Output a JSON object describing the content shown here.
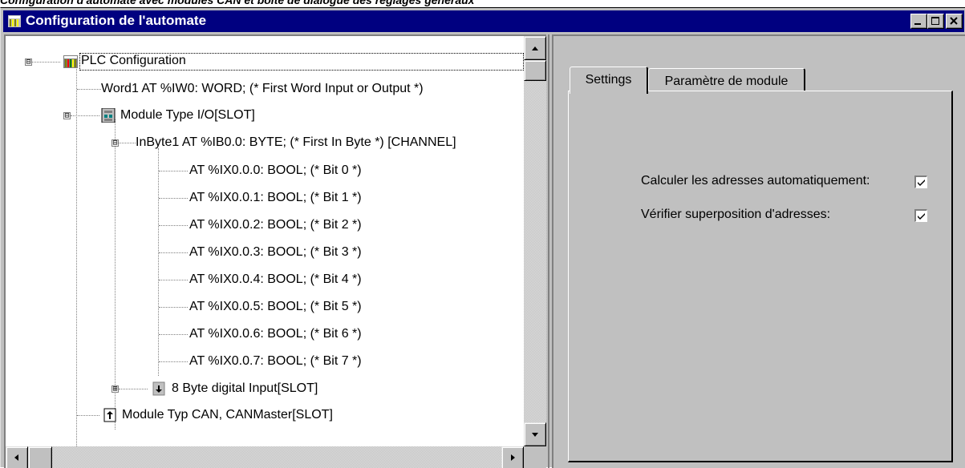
{
  "caption": "Configuration d'automate avec modules CAN et boîte de dialogue des réglages généraux",
  "window": {
    "title": "Configuration de l'automate",
    "icon": "plc-config-icon",
    "controls": [
      "minimize",
      "maximize",
      "close"
    ]
  },
  "tree": {
    "nodes": [
      {
        "label": "PLC Configuration",
        "icon": "plc-rack-icon",
        "expander": "⊟"
      },
      {
        "label": "Word1 AT %IW0: WORD; (* First Word Input or Output *)"
      },
      {
        "label": "Module Type I/O[SLOT]",
        "icon": "io-module-icon",
        "expander": "⊟"
      },
      {
        "label": "InByte1 AT %IB0.0: BYTE; (* First In Byte *) [CHANNEL]",
        "expander": "⊟"
      },
      {
        "label": "AT %IX0.0.0: BOOL; (* Bit 0 *)"
      },
      {
        "label": "AT %IX0.0.1: BOOL; (* Bit 1 *)"
      },
      {
        "label": "AT %IX0.0.2: BOOL; (* Bit 2 *)"
      },
      {
        "label": "AT %IX0.0.3: BOOL; (* Bit 3 *)"
      },
      {
        "label": "AT %IX0.0.4: BOOL; (* Bit 4 *)"
      },
      {
        "label": "AT %IX0.0.5: BOOL; (* Bit 5 *)"
      },
      {
        "label": "AT %IX0.0.6: BOOL; (* Bit 6 *)"
      },
      {
        "label": "AT %IX0.0.7: BOOL; (* Bit 7 *)"
      },
      {
        "label": "8 Byte digital Input[SLOT]",
        "icon": "digital-input-icon",
        "expander": "⊞"
      },
      {
        "label": "Module Typ CAN, CANMaster[SLOT]",
        "icon": "can-master-icon"
      }
    ]
  },
  "tabs": [
    {
      "label": "Settings",
      "active": true
    },
    {
      "label": "Paramètre de module",
      "active": false
    }
  ],
  "settings": {
    "auto_address_label": "Calculer les adresses automatiquement:",
    "auto_address_checked": true,
    "overlap_check_label": "Vérifier superposition d'adresses:",
    "overlap_check_checked": true
  },
  "colors": {
    "titlebar": "#000080",
    "face": "#c0c0c0"
  }
}
